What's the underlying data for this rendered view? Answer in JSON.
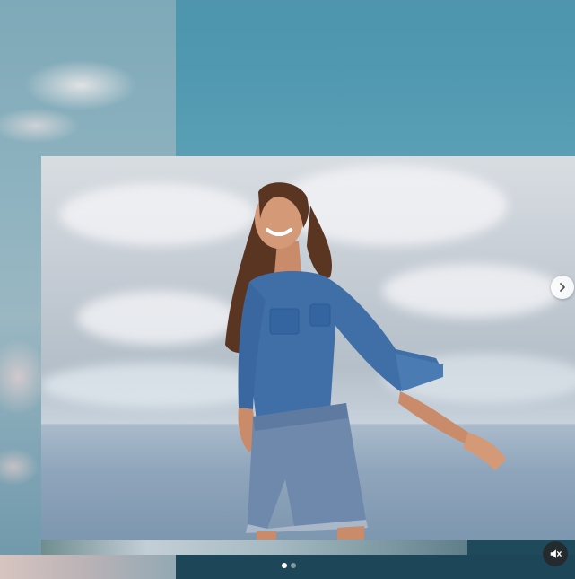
{
  "media": {
    "description_icons": {
      "next": "chevron-right-icon",
      "mute": "speaker-muted-icon"
    },
    "carousel": {
      "total_slides": 2,
      "active_slide": 1
    },
    "colors": {
      "sky_teal": "#4f98b0",
      "band_dark": "#1d4659",
      "denim": "#3f6fa6"
    }
  }
}
